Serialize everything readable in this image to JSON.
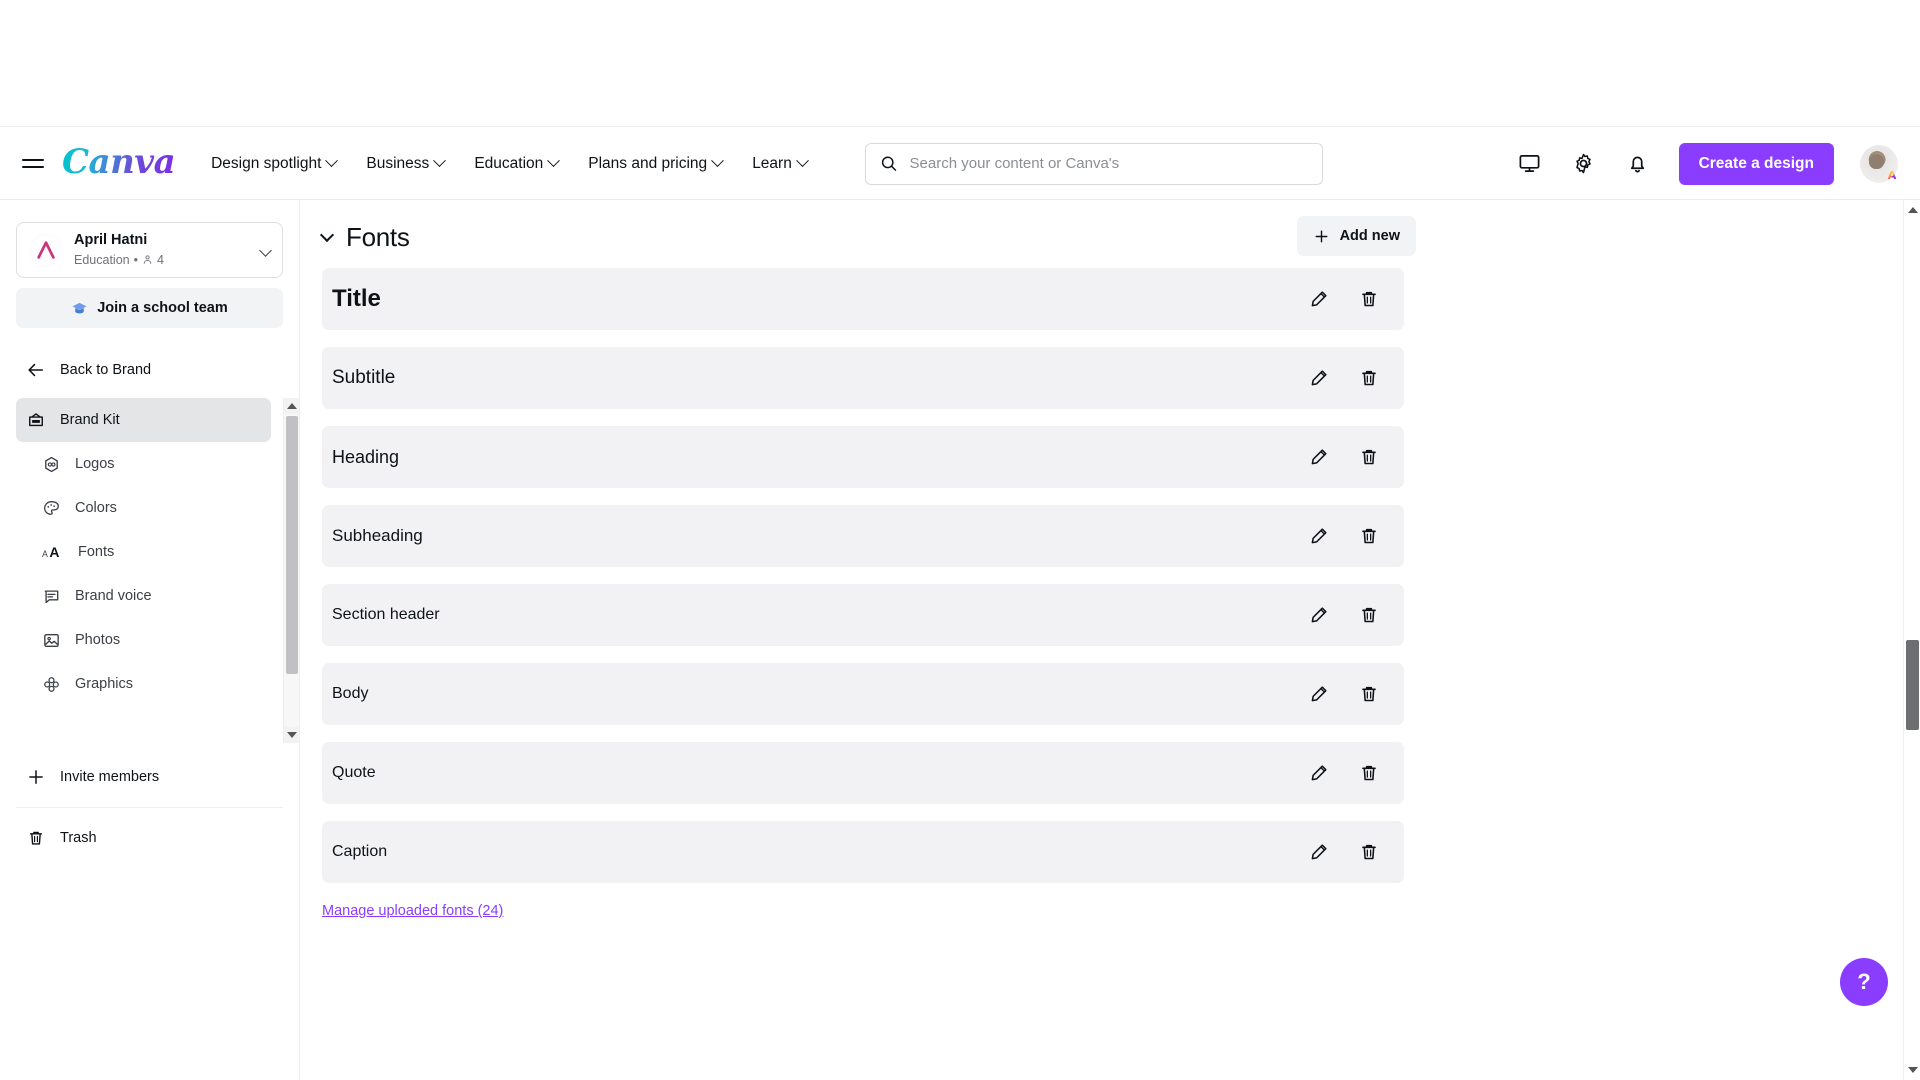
{
  "header": {
    "menu_icon": "hamburger-icon",
    "logo_text": "Canva",
    "nav": [
      {
        "label": "Design spotlight"
      },
      {
        "label": "Business"
      },
      {
        "label": "Education"
      },
      {
        "label": "Plans and pricing"
      },
      {
        "label": "Learn"
      }
    ],
    "search": {
      "placeholder": "Search your content or Canva's",
      "value": "",
      "icon": "search-icon"
    },
    "icons": [
      {
        "name": "monitor-icon"
      },
      {
        "name": "gear-icon"
      },
      {
        "name": "bell-icon"
      }
    ],
    "create_button": "Create a design",
    "avatar_badge": "A"
  },
  "sidebar": {
    "team": {
      "name": "April Hatni",
      "subtitle": "Education",
      "separator": "•",
      "member_count": "4",
      "chevron": "chevron-down-icon"
    },
    "join_team": {
      "label": "Join a school team",
      "icon": "graduation-cap-icon"
    },
    "back": {
      "label": "Back to Brand",
      "icon": "arrow-left-icon"
    },
    "items": [
      {
        "label": "Brand Kit",
        "icon": "brand-kit-icon",
        "active": true,
        "sub": false
      },
      {
        "label": "Logos",
        "icon": "logo-icon",
        "active": false,
        "sub": true
      },
      {
        "label": "Colors",
        "icon": "palette-icon",
        "active": false,
        "sub": true
      },
      {
        "label": "Fonts",
        "icon": "font-size-icon",
        "active": false,
        "sub": true
      },
      {
        "label": "Brand voice",
        "icon": "chat-bubble-icon",
        "active": false,
        "sub": true
      },
      {
        "label": "Photos",
        "icon": "image-icon",
        "active": false,
        "sub": true
      },
      {
        "label": "Graphics",
        "icon": "flower-icon",
        "active": false,
        "sub": true
      }
    ],
    "bottom_items": [
      {
        "label": "Invite members",
        "icon": "plus-icon"
      },
      {
        "label": "Trash",
        "icon": "trash-icon"
      }
    ]
  },
  "main": {
    "section_title": "Fonts",
    "collapse_icon": "chevron-down-icon",
    "add_new": {
      "label": "Add new",
      "icon": "plus-icon"
    },
    "rows": [
      {
        "label": "Title",
        "size": "24px",
        "weight": "700"
      },
      {
        "label": "Subtitle",
        "size": "19px",
        "weight": "400"
      },
      {
        "label": "Heading",
        "size": "18px",
        "weight": "400"
      },
      {
        "label": "Subheading",
        "size": "17px",
        "weight": "400"
      },
      {
        "label": "Section header",
        "size": "16px",
        "weight": "400"
      },
      {
        "label": "Body",
        "size": "16px",
        "weight": "400"
      },
      {
        "label": "Quote",
        "size": "16px",
        "weight": "400"
      },
      {
        "label": "Caption",
        "size": "16px",
        "weight": "400"
      }
    ],
    "row_actions": [
      {
        "name": "edit-icon",
        "title": "Edit"
      },
      {
        "name": "delete-icon",
        "title": "Delete"
      }
    ],
    "manage_link": "Manage uploaded fonts (24)"
  },
  "help": {
    "label": "?"
  },
  "colors": {
    "brand_purple": "#8b3dff",
    "row_background": "#f2f2f4",
    "active_sidebar": "#e4e5e7",
    "text_primary": "#0e1318",
    "text_muted": "#6e7178",
    "link_purple": "#8b3dff"
  }
}
